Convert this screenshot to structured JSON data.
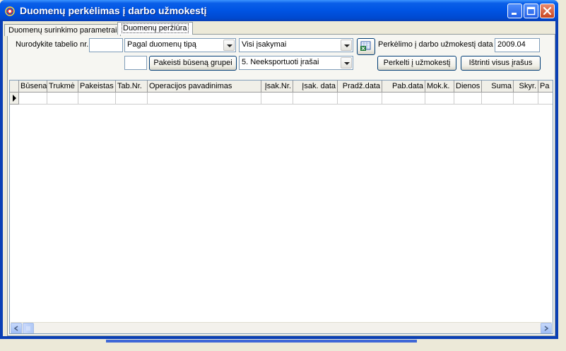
{
  "window": {
    "title": "Duomenų perkėlimas į darbo užmokestį"
  },
  "tabs": [
    {
      "label": "Duomenų surinkimo parametrai"
    },
    {
      "label": "Duomenų peržiūra"
    }
  ],
  "filters": {
    "tabelio_label": "Nurodykite tabelio nr.",
    "tabelio_value": "",
    "type_select": "Pagal duomenų tipą",
    "orders_select": "Visi įsakymai",
    "status_group_value": "",
    "change_status_button": "Pakeisti būseną grupei",
    "records_select": "5. Neeksportuoti įrašai",
    "transfer_date_label": "Perkėlimo į darbo užmokestį data",
    "transfer_date_value": "2009.04",
    "transfer_button": "Perkelti į užmokestį",
    "delete_all_button": "Ištrinti visus įrašus"
  },
  "grid": {
    "columns": [
      "Būsena",
      "Trukmė",
      "Pakeistas",
      "Tab.Nr.",
      "Operacijos pavadinimas",
      "Įsak.Nr.",
      "Įsak. data",
      "Pradž.data",
      "Pab.data",
      "Mok.k.",
      "Dienos",
      "Suma",
      "Skyr.",
      "Pa"
    ],
    "rows": []
  },
  "icons": {
    "app": "app-icon",
    "export": "excel-export-icon"
  },
  "colors": {
    "titlebar": "#0054e3",
    "close": "#c9461f",
    "background": "#ece9d8"
  }
}
